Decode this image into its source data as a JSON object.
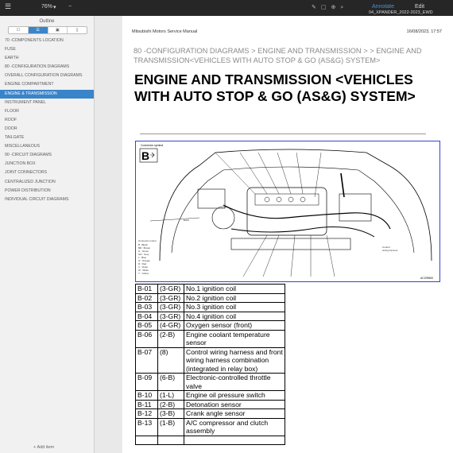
{
  "topbar": {
    "menu_icon": "menu-icon",
    "zoom": "76%",
    "zoom_icon": "chevron-down-icon",
    "actions": [
      "Annotate",
      "Edit"
    ],
    "filename": "04_XPANDER_2022-2023_EWD"
  },
  "sidebar": {
    "title": "Outline",
    "tabs": [
      "☐",
      "☰",
      "▣",
      "▯"
    ],
    "items": [
      "70 -COMPONENTS LOCATION",
      "FUSE",
      "EARTH",
      "80 -CONFIGURATION DIAGRAMS",
      "OVERALL CONFIGURATION DIAGRAMS",
      "ENGINE COMPARTMENT",
      "ENGINE & TRANSMISSION",
      "INSTRUMENT PANEL",
      "FLOOR",
      "ROOF",
      "DOOR",
      "TAILGATE",
      "MISCELLANEOUS",
      "90 -CIRCUIT DIAGRAMS",
      "JUNCTION BOX",
      "JOINT CONNECTORS",
      "CENTRALIZED JUNCTION",
      "POWER DISTRIBUTION",
      "INDIVIDUAL CIRCUIT DIAGRAMS"
    ],
    "active_index": 6,
    "add_item": "Add item"
  },
  "page": {
    "header_left": "Mitsubishi Motors Service Manual",
    "header_right": "16/08/2023, 17:57",
    "breadcrumb": "80 -CONFIGURATION DIAGRAMS > ENGINE AND TRANSMISSION > > ENGINE AND TRANSMISSION<VEHICLES WITH AUTO STOP & GO (AS&G) SYSTEM>",
    "title": "ENGINE AND TRANSMISSION <VEHICLES WITH AUTO STOP & GO (AS&G) SYSTEM>"
  },
  "diagram": {
    "connector_label": "Connector symbol",
    "letter": "B",
    "code": "AC209600"
  },
  "parts_table": [
    [
      "B-01",
      "(3-GR)",
      "No.1 ignition coil"
    ],
    [
      "B-02",
      "(3-GR)",
      "No.2 ignition coil"
    ],
    [
      "B-03",
      "(3-GR)",
      "No.3 ignition coil"
    ],
    [
      "B-04",
      "(3-GR)",
      "No.4 ignition coil"
    ],
    [
      "B-05",
      "(4-GR)",
      "Oxygen sensor (front)"
    ],
    [
      "B-06",
      "(2-B)",
      "Engine coolant temperature sensor"
    ],
    [
      "B-07",
      "(8)",
      "Control wiring harness and front wiring harness combination (integrated in relay box)"
    ],
    [
      "B-09",
      "(6-B)",
      "Electronic-controlled throttle valve"
    ],
    [
      "B-10",
      "(1-L)",
      "Engine oil pressure switch"
    ],
    [
      "B-11",
      "(2-B)",
      "Detonation sensor"
    ],
    [
      "B-12",
      "(3-B)",
      "Crank angle sensor"
    ],
    [
      "B-13",
      "(1-B)",
      "A/C compressor and clutch assembly"
    ]
  ]
}
